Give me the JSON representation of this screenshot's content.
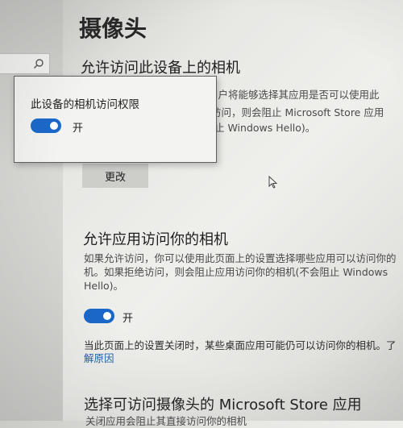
{
  "page": {
    "title": "摄像头"
  },
  "device_access": {
    "heading": "允许访问此设备上的相机",
    "lines": [
      "用户将能够选择其应用是否可以使用此",
      "访问，则会阻止 Microsoft Store 应用",
      "止 Windows Hello)。"
    ],
    "change_button": "更改"
  },
  "popup": {
    "title": "此设备的相机访问权限",
    "toggle_state": "开",
    "toggle_on": true
  },
  "app_access": {
    "heading": "允许应用访问你的相机",
    "lines": [
      "如果允许访问，你可以使用此页面上的设置选择哪些应用可以访问你的",
      "机。如果拒绝访问，则会阻止应用访问你的相机(不会阻止 Windows",
      "Hello)。"
    ],
    "toggle_state": "开",
    "toggle_on": true,
    "notice_line1": "当此页面上的设置关闭时，某些桌面应用可能仍可以访问你的相机。了",
    "notice_link": "解原因"
  },
  "store_apps": {
    "heading": "选择可访问摄像头的 Microsoft Store 应用",
    "subtext": "关闭应用会阻止其直接访问你的相机"
  },
  "colors": {
    "accent": "#1a67c9",
    "link": "#1a5fb4"
  },
  "icons": {
    "search": "search-icon",
    "cursor": "mouse-pointer-icon"
  }
}
